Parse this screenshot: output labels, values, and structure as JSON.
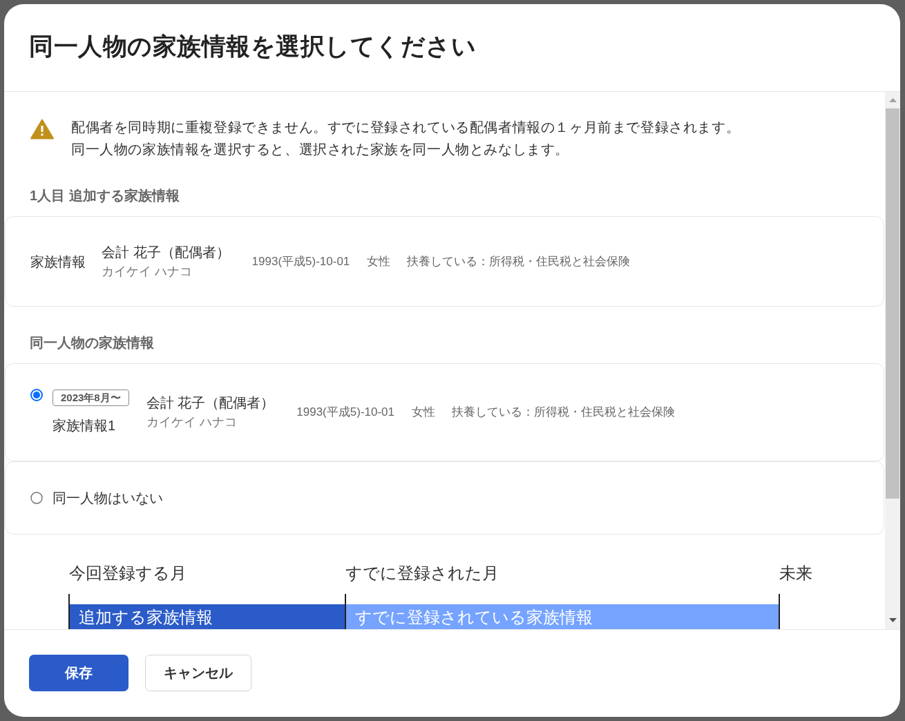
{
  "dialog": {
    "title": "同一人物の家族情報を選択してください"
  },
  "notice": {
    "lines": [
      "配偶者を同時期に重複登録できません。すでに登録されている配偶者情報の１ヶ月前まで登録されます。",
      "同一人物の家族情報を選択すると、選択された家族を同一人物とみなします。"
    ]
  },
  "added_section": {
    "heading": "1人目 追加する家族情報",
    "record": {
      "label": "家族情報",
      "name": "会計 花子（配偶者）",
      "kana": "カイケイ ハナコ",
      "birth_date": "1993(平成5)-10-01",
      "gender": "女性",
      "dependency": "扶養している：所得税・住民税と社会保険"
    }
  },
  "same_person_section": {
    "heading": "同一人物の家族情報",
    "options": [
      {
        "kind": "record",
        "selected": true,
        "period": "2023年8月〜",
        "label": "家族情報1",
        "name": "会計 花子（配偶者）",
        "kana": "カイケイ ハナコ",
        "birth_date": "1993(平成5)-10-01",
        "gender": "女性",
        "dependency": "扶養している：所得税・住民税と社会保険"
      },
      {
        "kind": "none",
        "selected": false,
        "label": "同一人物はいない"
      }
    ]
  },
  "timeline": {
    "columns": [
      {
        "heading": "今回登録する月",
        "bar": "追加する家族情報",
        "color": "#2a5bc8"
      },
      {
        "heading": "すでに登録された月",
        "bar": "すでに登録されている家族情報",
        "color": "#75a3ff"
      },
      {
        "heading": "未来"
      }
    ]
  },
  "buttons": [
    {
      "label": "保存",
      "kind": "primary"
    },
    {
      "label": "キャンセル",
      "kind": "secondary"
    }
  ]
}
